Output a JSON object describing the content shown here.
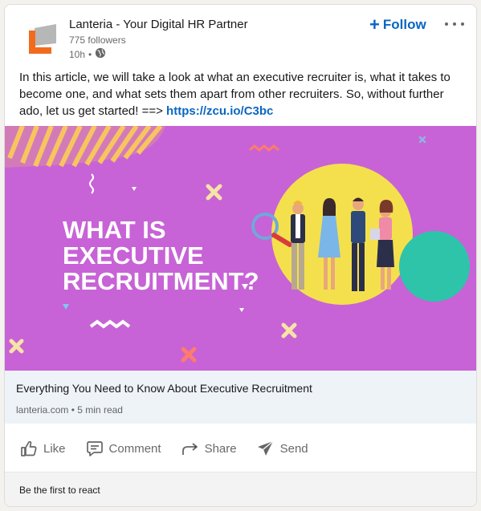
{
  "post": {
    "actor": {
      "name": "Lanteria - Your Digital HR Partner",
      "followers": "775 followers",
      "time": "10h",
      "separator": "•"
    },
    "follow": {
      "label": "Follow"
    },
    "commentary": {
      "text": "In this article, we will take a look at what an executive recruiter is, what it takes to become one, and what sets them apart from other recruiters. So, without further ado, let us get started! ==> ",
      "link": "https://zcu.io/C3bc"
    },
    "banner": {
      "headline_line1": "WHAT IS",
      "headline_line2": "EXECUTIVE",
      "headline_line3": "RECRUITMENT?"
    },
    "article": {
      "title": "Everything You Need to Know About Executive Recruitment",
      "source": "lanteria.com",
      "read_time": "5 min read",
      "separator": "•"
    },
    "actions": [
      {
        "label": "Like",
        "icon": "like-icon"
      },
      {
        "label": "Comment",
        "icon": "comment-icon"
      },
      {
        "label": "Share",
        "icon": "share-icon"
      },
      {
        "label": "Send",
        "icon": "send-icon"
      }
    ],
    "reactions": {
      "text": "Be the first to react"
    }
  },
  "colors": {
    "brand_blue": "#0a66c2",
    "banner_purple": "#c763d6",
    "circle_yellow": "#f4e04d",
    "circle_teal": "#2ec4a9",
    "logo_orange": "#f26b1d",
    "logo_gray": "#b7b7b7"
  }
}
